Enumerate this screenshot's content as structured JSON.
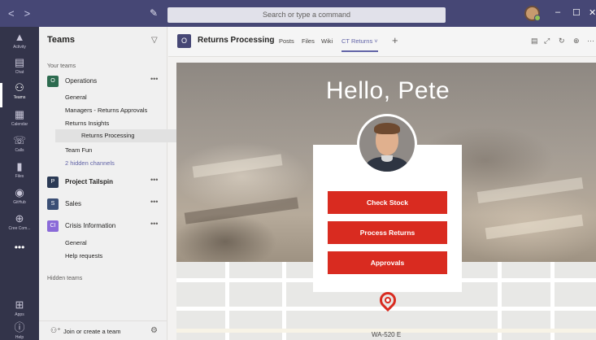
{
  "titlebar": {
    "nav_back": "<",
    "nav_forward": ">",
    "compose_glyph": "✎",
    "search_placeholder": "Search or type a command",
    "minimize": "–",
    "maximize": "☐",
    "close": "✕"
  },
  "appbar": {
    "items": [
      {
        "label": "Activity",
        "icon": "bell-icon",
        "glyph": "🔔"
      },
      {
        "label": "Chat",
        "icon": "chat-icon",
        "glyph": "▤"
      },
      {
        "label": "Teams",
        "icon": "teams-icon",
        "glyph": "⚇"
      },
      {
        "label": "Calendar",
        "icon": "calendar-icon",
        "glyph": "▦"
      },
      {
        "label": "Calls",
        "icon": "phone-icon",
        "glyph": "☏"
      },
      {
        "label": "Files",
        "icon": "file-icon",
        "glyph": "▮"
      },
      {
        "label": "GitHub",
        "icon": "github-icon",
        "glyph": "◉"
      },
      {
        "label": "Cree Com...",
        "icon": "globe-icon",
        "glyph": "⊕"
      }
    ],
    "more": "•••",
    "apps_label": "Apps",
    "help_label": "Help"
  },
  "teams_panel": {
    "title": "Teams",
    "your_teams_label": "Your teams",
    "hidden_teams_label": "Hidden teams",
    "teams": [
      {
        "name": "Operations",
        "color": "#2d6b4f",
        "abbr": "O",
        "bold": false,
        "channels": [
          "General",
          "Managers - Returns Approvals",
          "Returns Insights",
          "Returns Processing",
          "Team Fun"
        ],
        "hidden": "2 hidden channels"
      },
      {
        "name": "Project Tailspin",
        "color": "#2b3a55",
        "abbr": "P",
        "bold": true
      },
      {
        "name": "Sales",
        "color": "#3b4f75",
        "abbr": "S",
        "bold": false
      },
      {
        "name": "Crisis Information",
        "color": "#8a6ad8",
        "abbr": "CI",
        "bold": false,
        "channels": [
          "General",
          "Help requests"
        ]
      }
    ],
    "more": "•••",
    "join_label": "Join or create a team"
  },
  "channel_header": {
    "name": "Returns Processing",
    "tabs": [
      "Posts",
      "Files",
      "Wiki",
      "CT Returns ˅"
    ],
    "add_tab": "+"
  },
  "app_content": {
    "greeting": "Hello, Pete",
    "actions": [
      "Check Stock",
      "Process Returns",
      "Approvals"
    ],
    "map_label": "WA-520 E",
    "accent": "#d92b20"
  }
}
